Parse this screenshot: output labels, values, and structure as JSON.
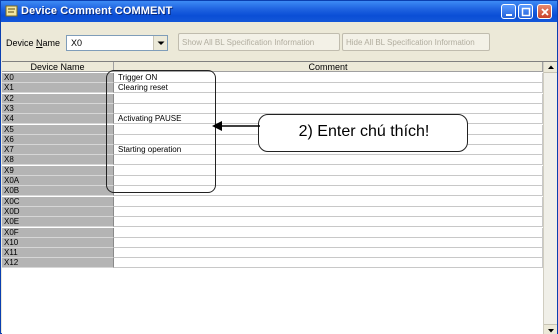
{
  "window": {
    "title": "Device Comment COMMENT",
    "icon": "app-icon",
    "controls": [
      "minimize-icon",
      "maximize-icon",
      "close-icon"
    ]
  },
  "toolbar": {
    "device_name_label_prefix": "Device ",
    "device_name_label_mnemonic": "N",
    "device_name_label_suffix": "ame",
    "device_name_value": "X0",
    "show_button_label": "Show All BL Specification Information",
    "hide_button_label": "Hide All BL Specification Information"
  },
  "grid": {
    "headers": [
      "Device Name",
      "Comment"
    ],
    "rows": [
      {
        "device": "X0",
        "comment": "Trigger ON"
      },
      {
        "device": "X1",
        "comment": "Clearing reset"
      },
      {
        "device": "X2",
        "comment": ""
      },
      {
        "device": "X3",
        "comment": ""
      },
      {
        "device": "X4",
        "comment": "Activating PAUSE"
      },
      {
        "device": "X5",
        "comment": ""
      },
      {
        "device": "X6",
        "comment": ""
      },
      {
        "device": "X7",
        "comment": "Starting operation"
      },
      {
        "device": "X8",
        "comment": ""
      },
      {
        "device": "X9",
        "comment": ""
      },
      {
        "device": "X0A",
        "comment": ""
      },
      {
        "device": "X0B",
        "comment": ""
      },
      {
        "device": "X0C",
        "comment": ""
      },
      {
        "device": "X0D",
        "comment": ""
      },
      {
        "device": "X0E",
        "comment": ""
      },
      {
        "device": "X0F",
        "comment": ""
      },
      {
        "device": "X10",
        "comment": ""
      },
      {
        "device": "X11",
        "comment": ""
      },
      {
        "device": "X12",
        "comment": ""
      }
    ]
  },
  "annotation": {
    "callout_text": "2) Enter chú thích!"
  },
  "colors": {
    "titlebar": "#0a4ed6",
    "device_column": "#b4b4b4",
    "window_bg": "#ece9d8"
  }
}
